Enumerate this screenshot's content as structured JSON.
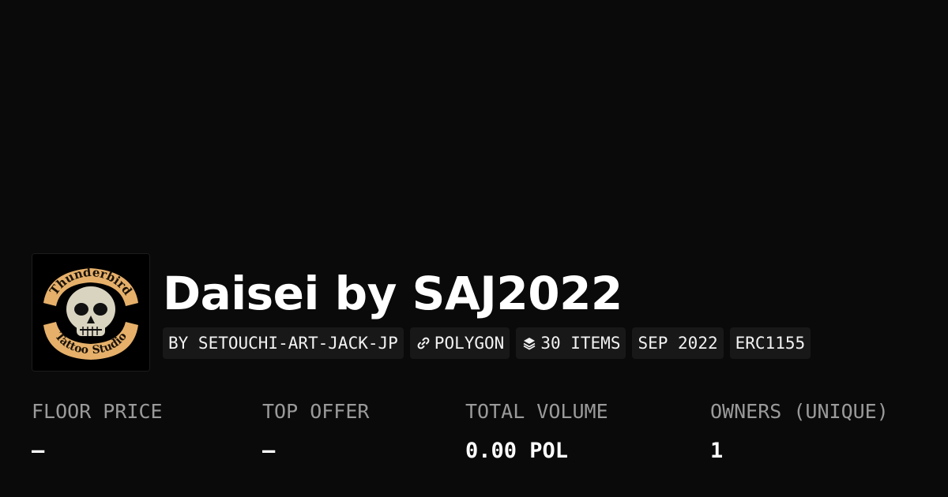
{
  "collection": {
    "title": "Daisei by SAJ2022",
    "logo": {
      "top_text": "Thunderbird",
      "bottom_text": "Tattoo Studio"
    }
  },
  "chips": {
    "creator": "BY SETOUCHI-ART-JACK-JP",
    "chain": "POLYGON",
    "chain_icon": "link-icon",
    "items": "30 ITEMS",
    "items_icon": "layers-icon",
    "date": "SEP 2022",
    "standard": "ERC1155"
  },
  "stats": {
    "floor_price": {
      "label": "FLOOR PRICE",
      "value": "—"
    },
    "top_offer": {
      "label": "TOP OFFER",
      "value": "—"
    },
    "total_volume": {
      "label": "TOTAL VOLUME",
      "value": "0.00 POL"
    },
    "owners": {
      "label": "OWNERS (UNIQUE)",
      "value": "1"
    }
  },
  "colors": {
    "background": "#0a0a0a",
    "chip_background": "#181818",
    "label": "#9a9a9a",
    "text": "#ffffff",
    "logo_banner": "#e6b06a"
  }
}
